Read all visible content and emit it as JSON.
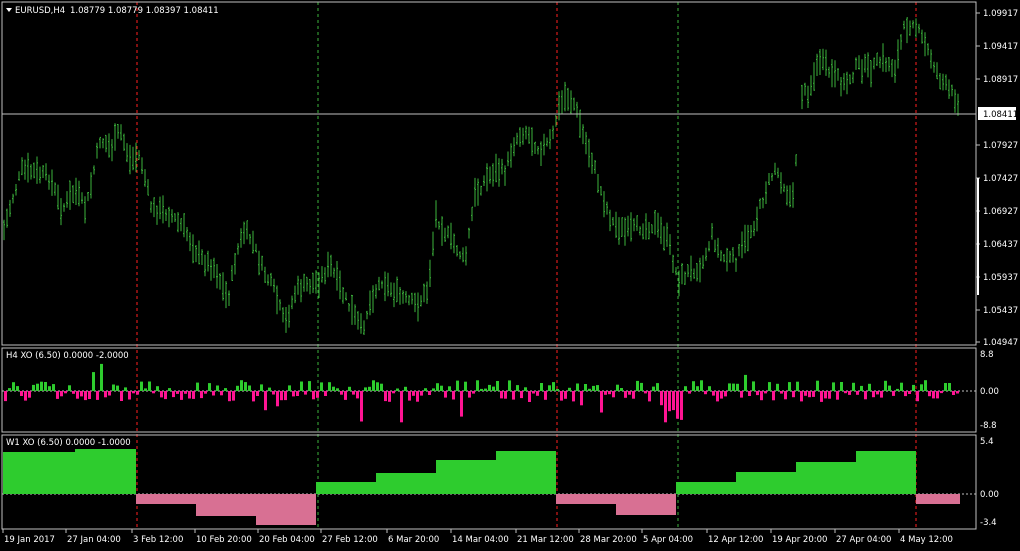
{
  "main": {
    "symbol_title": "EURUSD,H4",
    "ohlc": "1.08779 1.08779 1.08397 1.08411",
    "price_labels": [
      "1.09917",
      "1.09417",
      "1.08917",
      "1.07927",
      "1.07427",
      "1.06927",
      "1.06437",
      "1.05937",
      "1.05437",
      "1.04947"
    ],
    "current_price": "1.08411",
    "bar_color": "#3cb43c"
  },
  "h4": {
    "title": "H4 XO (6.50) 0.0000 -2.0000",
    "scale": [
      "8.8",
      "0.00",
      "-8.8"
    ],
    "up_color": "#2ecc2e",
    "down_color": "#ff1493"
  },
  "w1": {
    "title": "W1 XO (6.50) 0.0000 -1.0000",
    "scale": [
      "5.4",
      "0.00",
      "-3.4"
    ],
    "up_color": "#2ecc2e",
    "down_color": "#d87093"
  },
  "time_labels": [
    "19 Jan 2017",
    "27 Jan 04:00",
    "3 Feb 12:00",
    "10 Feb 20:00",
    "20 Feb 04:00",
    "27 Feb 12:00",
    "6 Mar 20:00",
    "14 Mar 04:00",
    "21 Mar 12:00",
    "28 Mar 20:00",
    "5 Apr 04:00",
    "12 Apr 12:00",
    "19 Apr 20:00",
    "27 Apr 04:00",
    "4 May 12:00"
  ],
  "colors": {
    "grid": "#c0c0c0",
    "red_sep": "#ff2020",
    "green_sep": "#3cb43c"
  }
}
